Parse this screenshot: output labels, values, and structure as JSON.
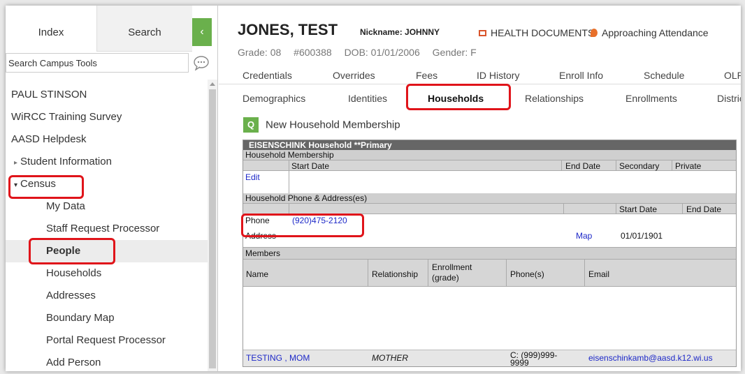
{
  "sidebar": {
    "tabs": {
      "index": "Index",
      "search": "Search"
    },
    "collapse_icon": "‹",
    "search_placeholder": "Search Campus Tools",
    "items": [
      {
        "label": "PAUL STINSON"
      },
      {
        "label": "WiRCC Training Survey"
      },
      {
        "label": "AASD Helpdesk"
      },
      {
        "label": "Student Information",
        "arrow": "▸"
      },
      {
        "label": "Census",
        "arrow": "▾"
      },
      {
        "label": "My Data"
      },
      {
        "label": "Staff Request Processor"
      },
      {
        "label": "People"
      },
      {
        "label": "Households"
      },
      {
        "label": "Addresses"
      },
      {
        "label": "Boundary Map"
      },
      {
        "label": "Portal Request Processor"
      },
      {
        "label": "Add Person"
      }
    ]
  },
  "student": {
    "name": "JONES, TEST",
    "nickname": "Nickname: JOHNNY",
    "health_documents": "HEALTH DOCUMENTS",
    "attendance_flag": "Approaching Attendance",
    "grade": "Grade: 08",
    "id": "#600388",
    "dob": "DOB: 01/01/2006",
    "gender": "Gender: F"
  },
  "nav_row1": [
    "Credentials",
    "Overrides",
    "Fees",
    "ID History",
    "Enroll Info",
    "Schedule",
    "OLR"
  ],
  "nav_row2": [
    "Demographics",
    "Identities",
    "Households",
    "Relationships",
    "Enrollments",
    "District"
  ],
  "new_household_label": "New Household Membership",
  "household": {
    "title": "EISENSCHINK Household **Primary",
    "membership_section": "Household Membership",
    "membership_columns": {
      "start_date": "Start Date",
      "end_date": "End Date",
      "secondary": "Secondary",
      "private": "Private"
    },
    "edit_link": "Edit",
    "phone_address_section": "Household Phone & Address(es)",
    "pa_columns": {
      "start_date": "Start Date",
      "end_date": "End Date"
    },
    "phone_label": "Phone",
    "phone_value": "(920)475-2120",
    "address_label": "Address",
    "map_link": "Map",
    "address_start_date": "01/01/1901",
    "members_section": "Members",
    "member_columns": {
      "name": "Name",
      "relationship": "Relationship",
      "enrollment_1": "Enrollment",
      "enrollment_2": "(grade)",
      "phones": "Phone(s)",
      "email": "Email"
    },
    "members": [
      {
        "name": "TESTING , MOM",
        "relationship": "MOTHER",
        "phone_1": "C:  (999)999-",
        "phone_2": "9999",
        "email": "eisenschinkamb@aasd.k12.wi.us"
      }
    ]
  },
  "colors": {
    "accent_green": "#6ab04c",
    "highlight_red": "#e0141a",
    "link_blue": "#1d28c8"
  }
}
